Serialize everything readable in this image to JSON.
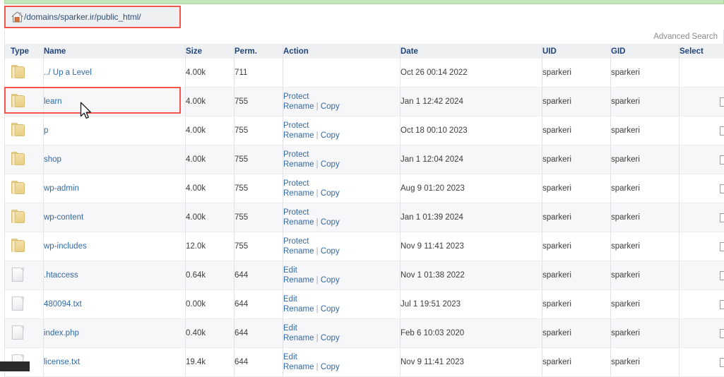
{
  "window": {
    "top_strip_color": "#c3e6b8",
    "highlight_color": "#f4544c"
  },
  "breadcrumb": {
    "icon": "home-icon",
    "path": "/domains/sparker.ir/public_html/"
  },
  "toolbar": {
    "advanced_search_label": "Advanced Search"
  },
  "table": {
    "columns": [
      {
        "key": "type",
        "label": "Type"
      },
      {
        "key": "name",
        "label": "Name"
      },
      {
        "key": "size",
        "label": "Size"
      },
      {
        "key": "perm",
        "label": "Perm."
      },
      {
        "key": "action",
        "label": "Action"
      },
      {
        "key": "date",
        "label": "Date"
      },
      {
        "key": "uid",
        "label": "UID"
      },
      {
        "key": "gid",
        "label": "GID"
      },
      {
        "key": "select",
        "label": "Select"
      }
    ],
    "action_labels": {
      "protect": "Protect",
      "edit": "Edit",
      "rename": "Rename",
      "copy": "Copy",
      "separator": "|"
    },
    "rows": [
      {
        "icon": "folder-icon",
        "name": "../ Up a Level",
        "size": "4.00k",
        "perm": "711",
        "primary_action": "",
        "rename": "",
        "copy": "",
        "date": "Oct 26 00:14 2022",
        "uid": "sparkeri",
        "gid": "sparkeri",
        "has_checkbox": false,
        "highlighted": false
      },
      {
        "icon": "folder-icon",
        "name": "learn",
        "size": "4.00k",
        "perm": "755",
        "primary_action": "Protect",
        "rename": "Rename",
        "copy": "Copy",
        "date": "Jan 1 12:42 2024",
        "uid": "sparkeri",
        "gid": "sparkeri",
        "has_checkbox": true,
        "highlighted": true
      },
      {
        "icon": "folder-icon",
        "name": "p",
        "size": "4.00k",
        "perm": "755",
        "primary_action": "Protect",
        "rename": "Rename",
        "copy": "Copy",
        "date": "Oct 18 00:10 2023",
        "uid": "sparkeri",
        "gid": "sparkeri",
        "has_checkbox": true,
        "highlighted": false
      },
      {
        "icon": "folder-icon",
        "name": "shop",
        "size": "4.00k",
        "perm": "755",
        "primary_action": "Protect",
        "rename": "Rename",
        "copy": "Copy",
        "date": "Jan 1 12:04 2024",
        "uid": "sparkeri",
        "gid": "sparkeri",
        "has_checkbox": true,
        "highlighted": false
      },
      {
        "icon": "folder-icon",
        "name": "wp-admin",
        "size": "4.00k",
        "perm": "755",
        "primary_action": "Protect",
        "rename": "Rename",
        "copy": "Copy",
        "date": "Aug 9 01:20 2023",
        "uid": "sparkeri",
        "gid": "sparkeri",
        "has_checkbox": true,
        "highlighted": false
      },
      {
        "icon": "folder-icon",
        "name": "wp-content",
        "size": "4.00k",
        "perm": "755",
        "primary_action": "Protect",
        "rename": "Rename",
        "copy": "Copy",
        "date": "Jan 1 01:39 2024",
        "uid": "sparkeri",
        "gid": "sparkeri",
        "has_checkbox": true,
        "highlighted": false
      },
      {
        "icon": "folder-icon",
        "name": "wp-includes",
        "size": "12.0k",
        "perm": "755",
        "primary_action": "Protect",
        "rename": "Rename",
        "copy": "Copy",
        "date": "Nov 9 11:41 2023",
        "uid": "sparkeri",
        "gid": "sparkeri",
        "has_checkbox": true,
        "highlighted": false
      },
      {
        "icon": "file-icon",
        "name": ".htaccess",
        "size": "0.64k",
        "perm": "644",
        "primary_action": "Edit",
        "rename": "Rename",
        "copy": "Copy",
        "date": "Nov 1 01:38 2022",
        "uid": "sparkeri",
        "gid": "sparkeri",
        "has_checkbox": true,
        "highlighted": false
      },
      {
        "icon": "file-icon",
        "name": "480094.txt",
        "size": "0.00k",
        "perm": "644",
        "primary_action": "Edit",
        "rename": "Rename",
        "copy": "Copy",
        "date": "Jul 1 19:51 2023",
        "uid": "sparkeri",
        "gid": "sparkeri",
        "has_checkbox": true,
        "highlighted": false
      },
      {
        "icon": "file-icon",
        "name": "index.php",
        "size": "0.40k",
        "perm": "644",
        "primary_action": "Edit",
        "rename": "Rename",
        "copy": "Copy",
        "date": "Feb 6 10:03 2020",
        "uid": "sparkeri",
        "gid": "sparkeri",
        "has_checkbox": true,
        "highlighted": false
      },
      {
        "icon": "file-icon",
        "name": "license.txt",
        "size": "19.4k",
        "perm": "644",
        "primary_action": "Edit",
        "rename": "Rename",
        "copy": "Copy",
        "date": "Nov 9 11:41 2023",
        "uid": "sparkeri",
        "gid": "sparkeri",
        "has_checkbox": true,
        "highlighted": false
      }
    ]
  }
}
